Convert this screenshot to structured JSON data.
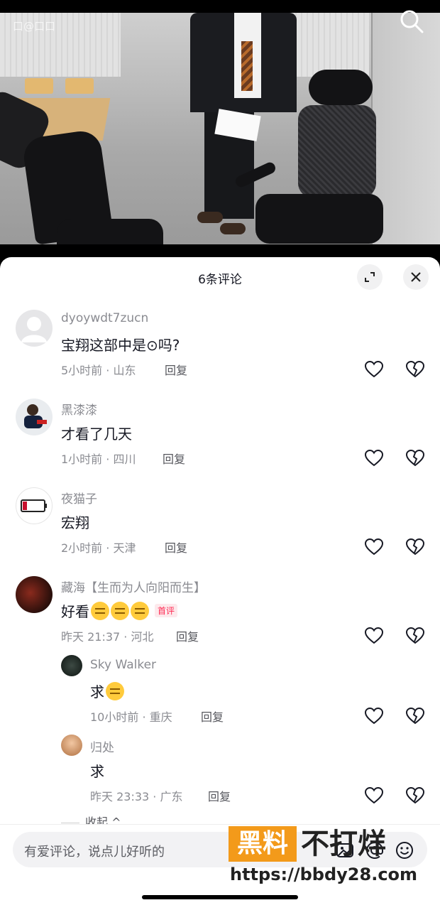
{
  "video": {
    "watermark": "口@口口"
  },
  "sheet": {
    "title": "6条评论"
  },
  "comments": [
    {
      "user": "dyoywdt7zucn",
      "text": "宝翔这部中是⊙吗?",
      "meta": "5小时前 · 山东",
      "reply": "回复"
    },
    {
      "user": "黑漆漆",
      "text": "才看了几天",
      "meta": "1小时前 · 四川",
      "reply": "回复"
    },
    {
      "user": "夜猫子",
      "text": "宏翔",
      "meta": "2小时前 · 天津",
      "reply": "回复"
    },
    {
      "user": "藏海【生而为人向阳而生】",
      "text": "好看",
      "badge": "首评",
      "meta": "昨天 21:37 · 河北",
      "reply": "回复"
    }
  ],
  "replies": [
    {
      "user": "Sky Walker",
      "text": "求",
      "meta": "10小时前 · 重庆",
      "reply": "回复"
    },
    {
      "user": "归处",
      "text": "求",
      "meta": "昨天 23:33 · 广东",
      "reply": "回复"
    }
  ],
  "collapse_label": "收起 ^",
  "input": {
    "placeholder": "有爱评论，说点儿好听的"
  },
  "watermark": {
    "brand_box": "黑料",
    "brand_text": "不打烊",
    "url": "https://bbdy28.com"
  }
}
